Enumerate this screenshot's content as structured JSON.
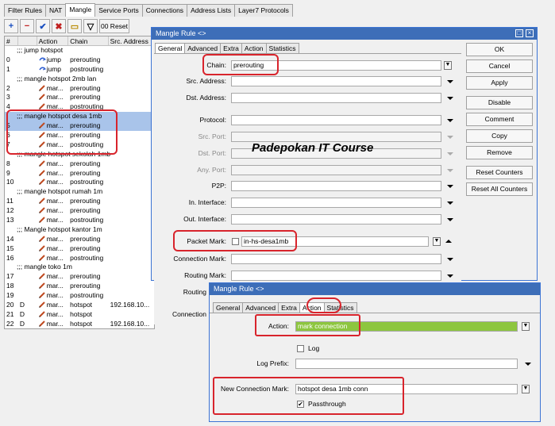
{
  "bg": {
    "tabs": [
      "Filter Rules",
      "NAT",
      "Mangle",
      "Service Ports",
      "Connections",
      "Address Lists",
      "Layer7 Protocols"
    ],
    "active_tab": "Mangle",
    "toolbar": {
      "add": "+",
      "remove": "−",
      "enable": "✔",
      "disable": "✖",
      "comment": "▭",
      "filter": "▽",
      "reset_counters": "00 Reset"
    },
    "columns": [
      "#",
      "",
      "Action",
      "Chain",
      "Src. Address"
    ],
    "rows": [
      {
        "type": "comment",
        "text": ";;; jump hotspot"
      },
      {
        "num": "0",
        "flag": "",
        "action": "jump",
        "chain": "prerouting",
        "src": ""
      },
      {
        "num": "1",
        "flag": "",
        "action": "jump",
        "chain": "postrouting",
        "src": ""
      },
      {
        "type": "comment",
        "text": ";;; mangle hotspot 2mb lan"
      },
      {
        "num": "2",
        "flag": "",
        "action": "mar...",
        "chain": "prerouting",
        "src": ""
      },
      {
        "num": "3",
        "flag": "",
        "action": "mar...",
        "chain": "prerouting",
        "src": ""
      },
      {
        "num": "4",
        "flag": "",
        "action": "mar...",
        "chain": "postrouting",
        "src": ""
      },
      {
        "type": "comment",
        "text": ";;; mangle hotspot desa 1mb",
        "sel": true
      },
      {
        "num": "5",
        "flag": "",
        "action": "mar...",
        "chain": "prerouting",
        "src": "",
        "sel": true
      },
      {
        "num": "6",
        "flag": "",
        "action": "mar...",
        "chain": "prerouting",
        "src": ""
      },
      {
        "num": "7",
        "flag": "",
        "action": "mar...",
        "chain": "postrouting",
        "src": ""
      },
      {
        "type": "comment",
        "text": ";;; mangle hotspot sekolah 1mb"
      },
      {
        "num": "8",
        "flag": "",
        "action": "mar...",
        "chain": "prerouting",
        "src": ""
      },
      {
        "num": "9",
        "flag": "",
        "action": "mar...",
        "chain": "prerouting",
        "src": ""
      },
      {
        "num": "10",
        "flag": "",
        "action": "mar...",
        "chain": "postrouting",
        "src": ""
      },
      {
        "type": "comment",
        "text": ";;; mangle hotspot rumah 1m"
      },
      {
        "num": "11",
        "flag": "",
        "action": "mar...",
        "chain": "prerouting",
        "src": ""
      },
      {
        "num": "12",
        "flag": "",
        "action": "mar...",
        "chain": "prerouting",
        "src": ""
      },
      {
        "num": "13",
        "flag": "",
        "action": "mar...",
        "chain": "postrouting",
        "src": ""
      },
      {
        "type": "comment",
        "text": ";;; Mangle hotspot kantor 1m"
      },
      {
        "num": "14",
        "flag": "",
        "action": "mar...",
        "chain": "prerouting",
        "src": ""
      },
      {
        "num": "15",
        "flag": "",
        "action": "mar...",
        "chain": "prerouting",
        "src": ""
      },
      {
        "num": "16",
        "flag": "",
        "action": "mar...",
        "chain": "postrouting",
        "src": ""
      },
      {
        "type": "comment",
        "text": ";;; mangle toko 1m"
      },
      {
        "num": "17",
        "flag": "",
        "action": "mar...",
        "chain": "prerouting",
        "src": ""
      },
      {
        "num": "18",
        "flag": "",
        "action": "mar...",
        "chain": "prerouting",
        "src": ""
      },
      {
        "num": "19",
        "flag": "",
        "action": "mar...",
        "chain": "postrouting",
        "src": ""
      },
      {
        "num": "20",
        "flag": "D",
        "action": "mar...",
        "chain": "hotspot",
        "src": "192.168.10..."
      },
      {
        "num": "21",
        "flag": "D",
        "action": "mar...",
        "chain": "hotspot",
        "src": ""
      },
      {
        "num": "22",
        "flag": "D",
        "action": "mar...",
        "chain": "hotspot",
        "src": "192.168.10..."
      }
    ]
  },
  "dlg1": {
    "title": "Mangle Rule <>",
    "tabs": [
      "General",
      "Advanced",
      "Extra",
      "Action",
      "Statistics"
    ],
    "chain_label": "Chain:",
    "chain_value": "prerouting",
    "src_label": "Src. Address:",
    "dst_label": "Dst. Address:",
    "protocol_label": "Protocol:",
    "src_port_label": "Src. Port:",
    "dst_port_label": "Dst. Port:",
    "any_port_label": "Any. Port:",
    "p2p_label": "P2P:",
    "in_iface_label": "In. Interface:",
    "out_iface_label": "Out. Interface:",
    "packet_mark_label": "Packet Mark:",
    "packet_mark_value": "in-hs-desa1mb",
    "conn_mark_label": "Connection Mark:",
    "routing_mark_label": "Routing Mark:",
    "routing_label2": "Routing",
    "connection_label2": "Connection",
    "buttons": [
      "OK",
      "Cancel",
      "Apply",
      "Disable",
      "Comment",
      "Copy",
      "Remove",
      "Reset Counters",
      "Reset All Counters"
    ]
  },
  "dlg2": {
    "title": "Mangle Rule <>",
    "tabs": [
      "General",
      "Advanced",
      "Extra",
      "Action",
      "Statistics"
    ],
    "action_label": "Action:",
    "action_value": "mark connection",
    "log_label": "Log",
    "log_prefix_label": "Log Prefix:",
    "new_conn_mark_label": "New Connection Mark:",
    "new_conn_mark_value": "hotspot desa 1mb conn",
    "passthrough_label": "Passthrough"
  },
  "watermark": "Padepokan IT Course",
  "colors": {
    "highlight": "#d8242c",
    "action_fill": "#8dc63f",
    "titlebar": "#3d6eb8",
    "selected_row": "#a9c4ea"
  }
}
